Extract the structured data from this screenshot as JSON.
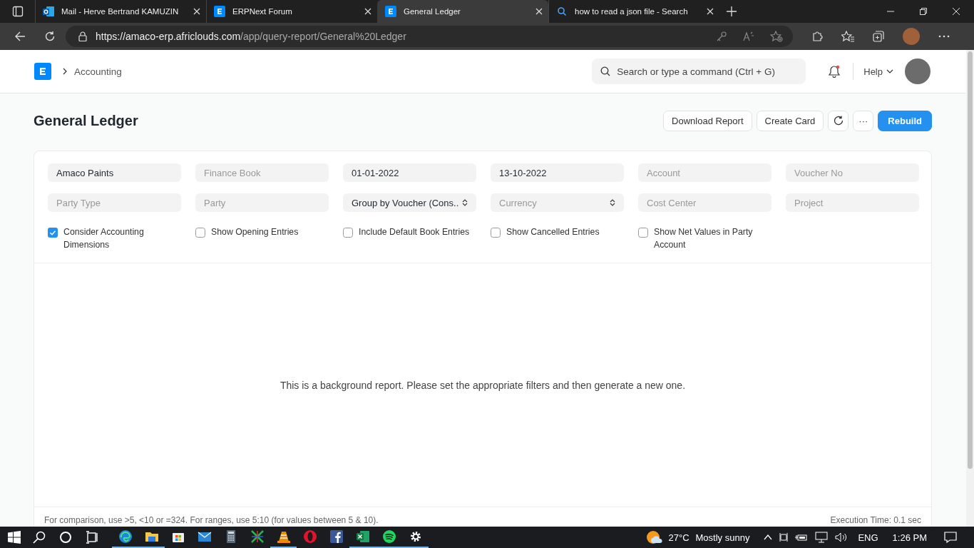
{
  "browser": {
    "tabs": [
      {
        "kind": "mail",
        "title": "Mail - Herve Bertrand KAMUZIN",
        "selected": false
      },
      {
        "kind": "erp",
        "title": "ERPNext Forum",
        "selected": false
      },
      {
        "kind": "erp",
        "title": "General Ledger",
        "selected": true
      },
      {
        "kind": "search",
        "title": "how to read a json file - Search",
        "selected": false
      }
    ],
    "url": {
      "host": "https://amaco-erp.africlouds.com",
      "path": "/app/query-report/General%20Ledger"
    }
  },
  "navbar": {
    "breadcrumb": "Accounting",
    "search_placeholder": "Search or type a command (Ctrl + G)",
    "notification_unread": true,
    "help": "Help"
  },
  "page": {
    "title": "General Ledger",
    "actions": [
      {
        "kind": "text",
        "label": "Download Report"
      },
      {
        "kind": "text",
        "label": "Create Card"
      },
      {
        "kind": "refresh"
      },
      {
        "kind": "more",
        "label": "···"
      },
      {
        "kind": "primary",
        "label": "Rebuild"
      }
    ]
  },
  "filters": [
    {
      "kind": "text",
      "value": "Amaco Paints"
    },
    {
      "kind": "text",
      "placeholder": "Finance Book"
    },
    {
      "kind": "text",
      "value": "01-01-2022"
    },
    {
      "kind": "text",
      "value": "13-10-2022"
    },
    {
      "kind": "text",
      "placeholder": "Account"
    },
    {
      "kind": "text",
      "placeholder": "Voucher No"
    },
    {
      "kind": "text",
      "placeholder": "Party Type"
    },
    {
      "kind": "text",
      "placeholder": "Party"
    },
    {
      "kind": "select",
      "value": "Group by Voucher (Cons.."
    },
    {
      "kind": "select",
      "placeholder": "Currency"
    },
    {
      "kind": "text",
      "placeholder": "Cost Center"
    },
    {
      "kind": "text",
      "placeholder": "Project"
    }
  ],
  "checkboxes": [
    {
      "label": "Consider Accounting Dimensions",
      "checked": true
    },
    {
      "label": "Show Opening Entries",
      "checked": false
    },
    {
      "label": "Include Default Book Entries",
      "checked": false
    },
    {
      "label": "Show Cancelled Entries",
      "checked": false
    },
    {
      "label": "Show Net Values in Party Account",
      "checked": false
    }
  ],
  "message": "This is a background report. Please set the appropriate filters and then generate a new one.",
  "footer": {
    "hint": "For comparison, use >5, <10 or =324. For ranges, use 5:10 (for values between 5 & 10).",
    "execution_time": "Execution Time: 0.1 sec"
  },
  "taskbar": {
    "apps": [
      {
        "kind": "edge",
        "active": true
      },
      {
        "kind": "folder",
        "active": true
      },
      {
        "kind": "store",
        "active": false
      },
      {
        "kind": "mail",
        "active": false
      },
      {
        "kind": "calculator",
        "active": false
      },
      {
        "kind": "xapp",
        "active": false
      },
      {
        "kind": "vlc",
        "active": true
      },
      {
        "kind": "opera",
        "active": false
      },
      {
        "kind": "facebook",
        "active": false
      },
      {
        "kind": "excel",
        "active": true
      },
      {
        "kind": "spotify",
        "active": true
      },
      {
        "kind": "settings",
        "active": true
      }
    ],
    "weather": {
      "temp": "27°C",
      "text": "Mostly sunny"
    },
    "language": "ENG",
    "time": "1:26 PM"
  }
}
